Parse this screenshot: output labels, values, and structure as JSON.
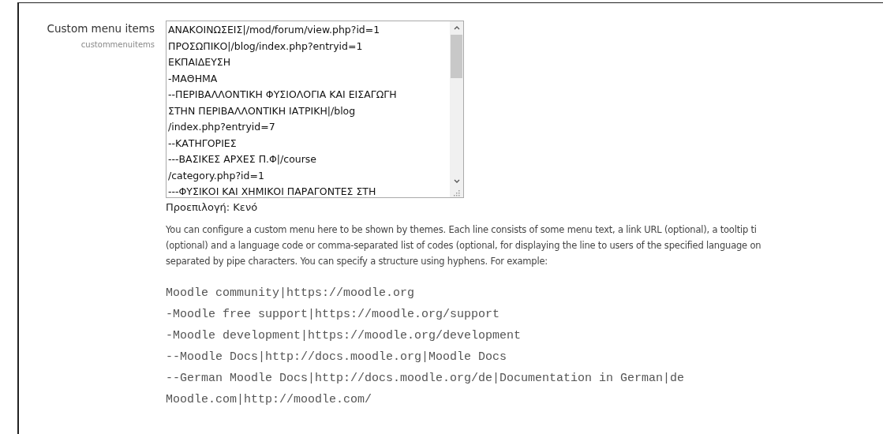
{
  "setting": {
    "label": "Custom menu items",
    "name": "custommenuitems",
    "value_lines": [
      "ΑΝΑΚΟΙΝΩΣΕΙΣ|/mod/forum/view.php?id=1",
      "ΠΡΟΣΩΠΙΚΟ|/blog/index.php?entryid=1",
      "ΕΚΠΑΙΔΕΥΣΗ",
      "-ΜΑΘΗΜΑ",
      "--ΠΕΡΙΒΑΛΛΟΝΤΙΚΗ ΦΥΣΙΟΛΟΓΙΑ ΚΑΙ ΕΙΣΑΓΩΓΗ",
      "ΣΤΗΝ ΠΕΡΙΒΑΛΛΟΝΤΙΚΗ ΙΑΤΡΙΚΗ|/blog",
      "/index.php?entryid=7",
      "--ΚΑΤΗΓΟΡΙΕΣ",
      "---ΒΑΣΙΚΕΣ ΑΡΧΕΣ Π.Φ|/course",
      "/category.php?id=1",
      "---ΦΥΣΙΚΟΙ ΚΑΙ ΧΗΜΙΚΟΙ ΠΑΡΑΓΟΝΤΕΣ ΣΤΗ"
    ],
    "default": "Προεπιλογή: Κενό",
    "description_lines": [
      "You can configure a custom menu here to be shown by themes. Each line consists of some menu text, a link URL (optional), a tooltip ti",
      "(optional) and a language code or comma-separated list of codes (optional, for displaying the line to users of the specified language on",
      "separated by pipe characters. You can specify a structure using hyphens. For example:"
    ],
    "example_lines": [
      "Moodle community|https://moodle.org",
      "-Moodle free support|https://moodle.org/support",
      "-Moodle development|https://moodle.org/development",
      "--Moodle Docs|http://docs.moodle.org|Moodle Docs",
      "--German Moodle Docs|http://docs.moodle.org/de|Documentation in German|de",
      "Moodle.com|http://moodle.com/"
    ]
  }
}
